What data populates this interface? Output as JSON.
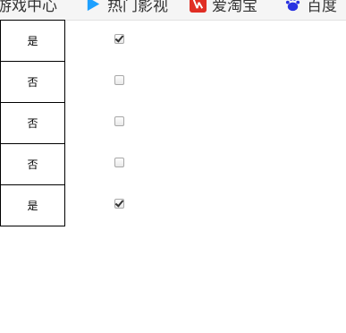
{
  "bookmarks": [
    {
      "label": "游戏中心",
      "icon": "game-center-icon"
    },
    {
      "label": "热门影视",
      "icon": "play-video-icon"
    },
    {
      "label": "爱淘宝",
      "icon": "aitaobao-icon"
    },
    {
      "label": "百度",
      "icon": "baidu-paw-icon"
    }
  ],
  "rows": [
    {
      "label": "是",
      "checked": true
    },
    {
      "label": "否",
      "checked": false
    },
    {
      "label": "否",
      "checked": false
    },
    {
      "label": "否",
      "checked": false
    },
    {
      "label": "是",
      "checked": true
    }
  ],
  "colors": {
    "play_icon": "#1ea0ff",
    "taobao_icon": "#e02e24",
    "baidu_icon": "#2932e1"
  }
}
